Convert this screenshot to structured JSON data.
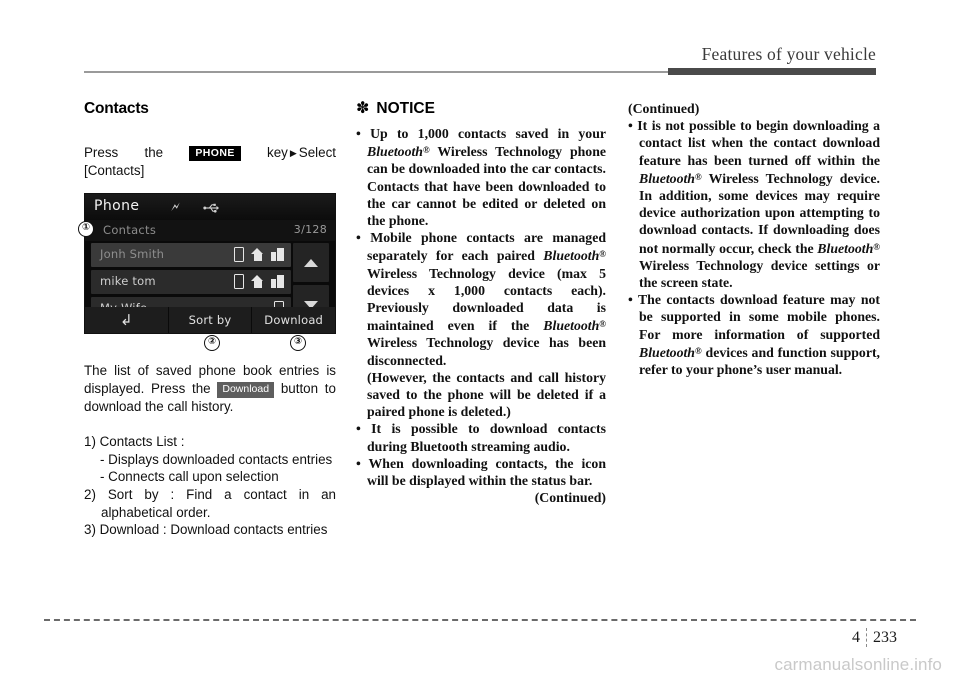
{
  "header": {
    "title": "Features of your vehicle"
  },
  "left_column": {
    "section_title": "Contacts",
    "press_line_pre": "Press",
    "press_line_the": "the",
    "key_chip": "PHONE",
    "press_line_key": "key",
    "press_line_select": "Select",
    "press_line_target": "[Contacts]",
    "device": {
      "title": "Phone",
      "bluetooth_icon": "bluetooth-icon",
      "usb_icon": "usb-icon",
      "sub_title": "Contacts",
      "count": "3/128",
      "rows": [
        {
          "name": "Jonh Smith",
          "icons": [
            "mobile-icon",
            "home-icon",
            "office-icon"
          ]
        },
        {
          "name": "mike tom",
          "icons": [
            "mobile-icon",
            "home-icon",
            "office-icon"
          ]
        },
        {
          "name": "My Wife",
          "icons": [
            "mobile-icon"
          ]
        }
      ],
      "scroll_up": "scroll-up-arrow",
      "scroll_down": "scroll-down-arrow",
      "buttons": [
        "back-arrow",
        "Sort by",
        "Download"
      ],
      "callouts": [
        "1",
        "2",
        "3"
      ]
    },
    "paragraph_1a": "The list of saved phone book entries is displayed. Press the",
    "download_chip": "Download",
    "paragraph_1b": "button to download the call history.",
    "items": [
      {
        "label": "1) Contacts List :",
        "subs": [
          "- Displays downloaded contacts entries",
          "- Connects call upon selection"
        ]
      },
      {
        "label": "2) Sort by : Find a contact in an alphabetical order.",
        "subs": []
      },
      {
        "label": "3) Download : Download contacts entries",
        "subs": []
      }
    ]
  },
  "middle_column": {
    "notice_asterisk": "✽",
    "notice_title": "NOTICE",
    "bullets": [
      {
        "parts": [
          {
            "t": "Up to 1,000 contacts saved in your "
          },
          {
            "t": "Bluetooth",
            "style": "italic"
          },
          {
            "t": "®",
            "style": "reg"
          },
          {
            "t": " Wireless Technology phone can be downloaded into the car contacts. Contacts that have been downloaded to the car cannot be edited or deleted on the phone."
          }
        ]
      },
      {
        "parts": [
          {
            "t": "Mobile phone contacts are managed separately for each paired "
          },
          {
            "t": "Bluetooth",
            "style": "italic"
          },
          {
            "t": "®",
            "style": "reg"
          },
          {
            "t": " Wireless Technology device (max 5 devices x 1,000 contacts each). Previously downloaded data is maintained even if the "
          },
          {
            "t": "Bluetooth",
            "style": "italic"
          },
          {
            "t": "®",
            "style": "reg"
          },
          {
            "t": " Wireless Technology device has been disconnected."
          }
        ]
      },
      {
        "parts": [
          {
            "t": "It is possible to download contacts during Bluetooth streaming audio."
          }
        ]
      },
      {
        "parts": [
          {
            "t": "When downloading contacts, the icon will be displayed within the status bar."
          }
        ]
      }
    ],
    "paren_note": "(However, the contacts and call history saved to the phone will be deleted if a paired phone is deleted.)",
    "continued": "(Continued)"
  },
  "right_column": {
    "continued_header": "(Continued)",
    "bullets": [
      {
        "parts": [
          {
            "t": "It is not possible to begin downloading a contact list when the contact download feature has been turned off within the "
          },
          {
            "t": "Bluetooth",
            "style": "italic"
          },
          {
            "t": "®",
            "style": "reg"
          },
          {
            "t": " Wireless Technology device. In addition, some devices may require device authorization upon attempting to download contacts. If downloading does not normally occur, check the "
          },
          {
            "t": "Bluetooth",
            "style": "italic"
          },
          {
            "t": "®",
            "style": "reg"
          },
          {
            "t": " Wireless Technology device settings or the screen state."
          }
        ]
      },
      {
        "parts": [
          {
            "t": "The contacts download feature may not be supported in some mobile phones. For more information of supported "
          },
          {
            "t": "Bluetooth",
            "style": "italic"
          },
          {
            "t": "®",
            "style": "reg"
          },
          {
            "t": " devices and function support, refer to your phone’s user manual."
          }
        ]
      }
    ]
  },
  "footer": {
    "chapter": "4",
    "page": "233",
    "watermark": "carmanualsonline.info"
  }
}
